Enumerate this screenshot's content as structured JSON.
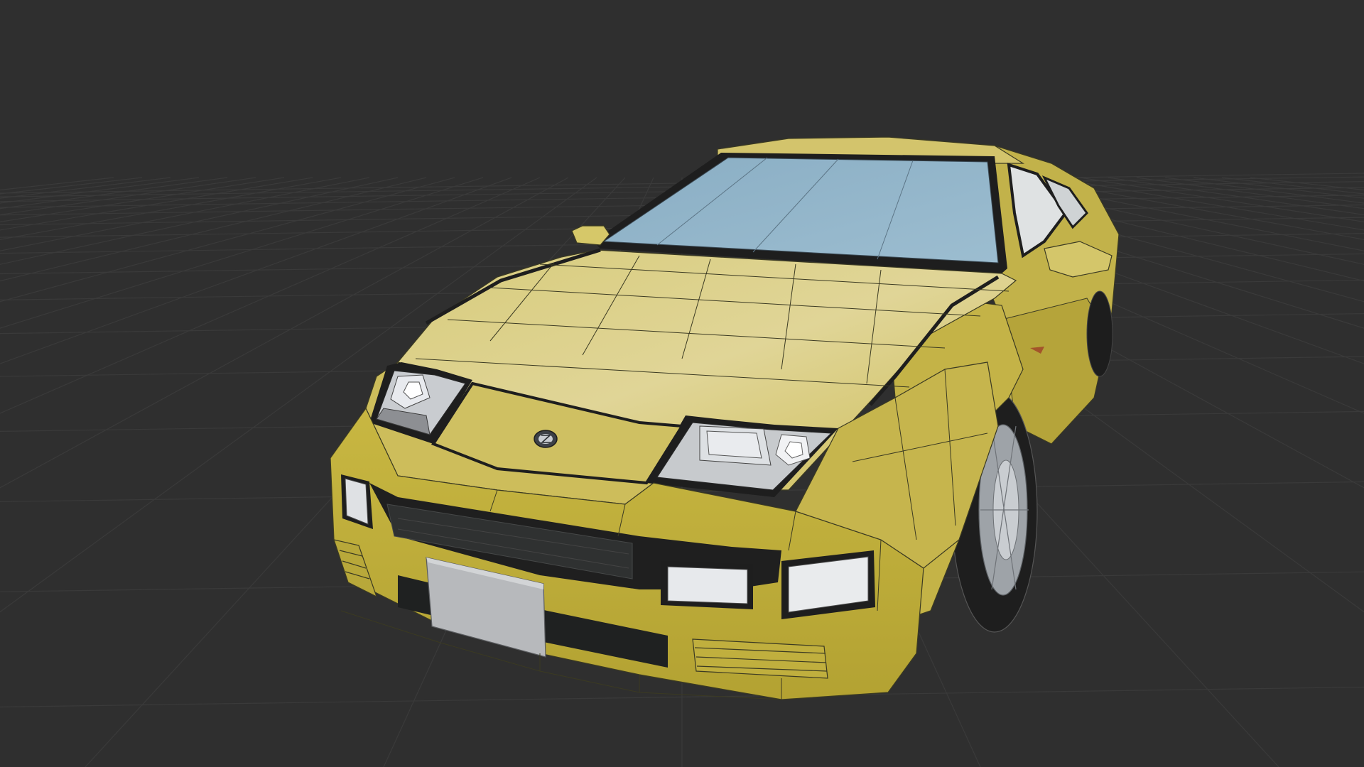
{
  "viewport": {
    "background_color": "#2f2f2f",
    "grid_color": "#3a3a3a"
  },
  "model": {
    "body_color": "#c9b94a",
    "body_highlight": "#ddd18e",
    "body_shadow": "#a9992f",
    "glass_color": "#8fb1c6",
    "trim_color": "#1e1e1e",
    "lamp_color": "#e4e6ea",
    "wireframe_color": "#3b3a22",
    "badge_icon": "z-badge-icon"
  }
}
